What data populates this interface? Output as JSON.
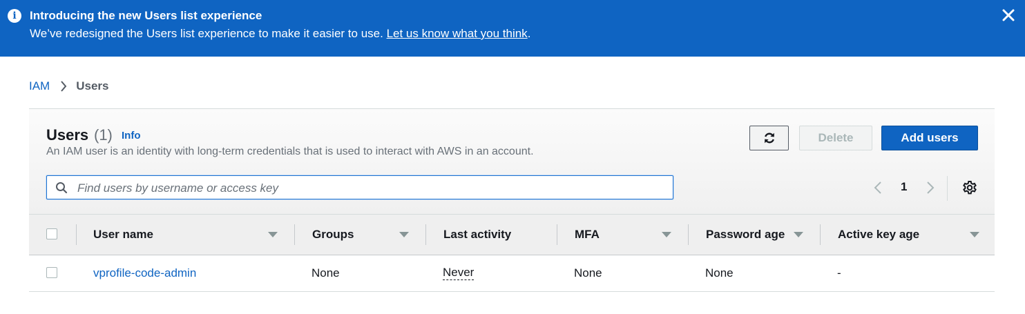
{
  "banner": {
    "title": "Introducing the new Users list experience",
    "message": "We’ve redesigned the Users list experience to make it easier to use.",
    "link": "Let us know what you think",
    "link_suffix": "."
  },
  "breadcrumb": {
    "root": "IAM",
    "current": "Users"
  },
  "users_panel": {
    "title": "Users",
    "count": "(1)",
    "info": "Info",
    "description": "An IAM user is an identity with long-term credentials that is used to interact with AWS in an account.",
    "delete_label": "Delete",
    "add_label": "Add users",
    "search_placeholder": "Find users by username or access key",
    "page": "1"
  },
  "table": {
    "columns": [
      "User name",
      "Groups",
      "Last activity",
      "MFA",
      "Password age",
      "Active key age"
    ],
    "rows": [
      [
        "vprofile-code-admin",
        "None",
        "Never",
        "None",
        "None",
        "-"
      ]
    ]
  },
  "colors": {
    "banner": "#0f64c2",
    "link": "#0f64c2",
    "primary_button": "#0f64c2"
  }
}
